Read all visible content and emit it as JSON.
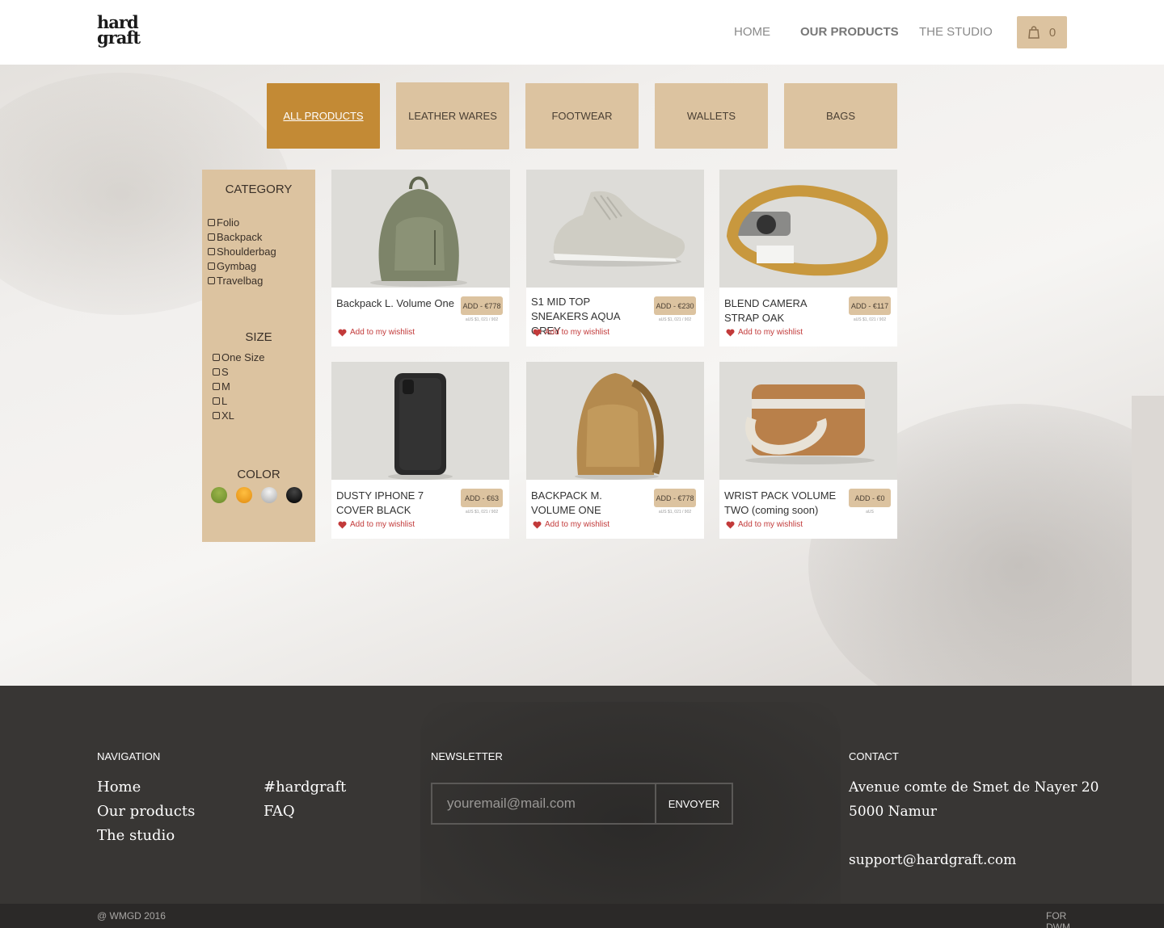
{
  "brand": {
    "logo_line1": "hard",
    "logo_line2": "graft"
  },
  "nav": {
    "home": "HOME",
    "products": "OUR PRODUCTS",
    "studio": "THE STUDIO",
    "cart_count": "0"
  },
  "categories": [
    "ALL PRODUCTS",
    "LEATHER WARES",
    "FOOTWEAR",
    "WALLETS",
    "BAGS"
  ],
  "filters": {
    "category_title": "CATEGORY",
    "category_options": [
      "Folio",
      "Backpack",
      "Shoulderbag",
      "Gymbag",
      "Travelbag"
    ],
    "size_title": "SIZE",
    "size_options": [
      "One Size",
      "S",
      "M",
      "L",
      "XL"
    ],
    "color_title": "COLOR",
    "colors": [
      "#7a9a3a",
      "#f0a020",
      "#d8d8d8",
      "#111111"
    ]
  },
  "products": [
    {
      "name": "Backpack L. Volume One",
      "add": "ADD - €778",
      "sub": "aUS $1, 021 / 902",
      "wish": "Add to my wishlist"
    },
    {
      "name": "S1 MID TOP SNEAKERS AQUA GREY",
      "add": "ADD - €230",
      "sub": "aUS $1, 021 / 902",
      "wish": "Add to my wishlist"
    },
    {
      "name": "BLEND CAMERA STRAP OAK",
      "add": "ADD - €117",
      "sub": "aUS $1, 021 / 902",
      "wish": "Add to my wishlist"
    },
    {
      "name": "DUSTY IPHONE 7 COVER BLACK",
      "add": "ADD - €63",
      "sub": "aUS $1, 021 / 902",
      "wish": "Add to my wishlist"
    },
    {
      "name": "BACKPACK M. VOLUME ONE",
      "add": "ADD - €778",
      "sub": "aUS $1, 021 / 902",
      "wish": "Add to my wishlist"
    },
    {
      "name": "WRIST PACK VOLUME TWO (coming soon)",
      "add": "ADD - €0",
      "sub": "aUS",
      "wish": "Add to my wishlist"
    }
  ],
  "footer": {
    "nav_title": "NAVIGATION",
    "nav_col1": [
      "Home",
      "Our products",
      "The studio"
    ],
    "nav_col2": [
      "#hardgraft",
      "FAQ"
    ],
    "newsletter_title": "NEWSLETTER",
    "newsletter_placeholder": "youremail@mail.com",
    "newsletter_button": "ENVOYER",
    "contact_title": "CONTACT",
    "address_line1": "Avenue comte de Smet de Nayer 20",
    "address_line2": "5000 Namur",
    "email": "support@hardgraft.com",
    "copyright": "@ WMGD 2016",
    "credit_line1": "FOR",
    "credit_line2": "DWM"
  },
  "theme": {
    "accent": "#c38a35",
    "tan": "#dcc3a0",
    "footer_bg": "#383634",
    "heart": "#c23a3a"
  }
}
